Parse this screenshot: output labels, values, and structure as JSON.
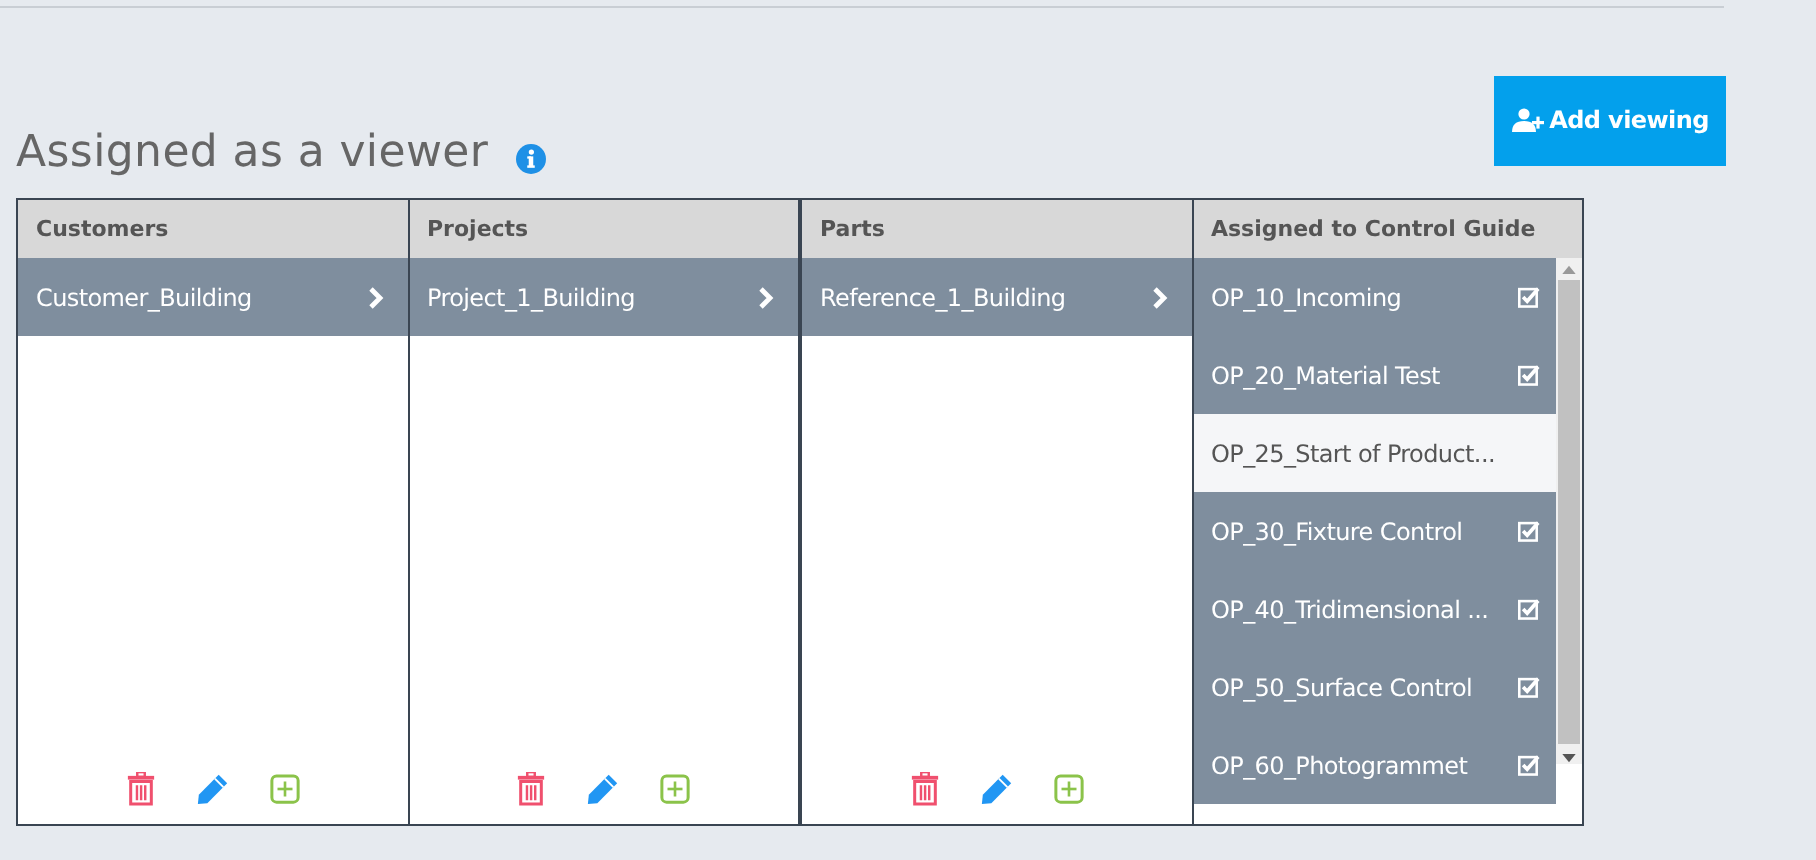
{
  "heading": "Assigned as a viewer",
  "add_button": "Add viewing",
  "columns": [
    {
      "title": "Customers",
      "items": [
        {
          "label": "Customer_Building",
          "selected": true
        }
      ]
    },
    {
      "title": "Projects",
      "items": [
        {
          "label": "Project_1_Building",
          "selected": true
        }
      ]
    },
    {
      "title": "Parts",
      "items": [
        {
          "label": "Reference_1_Building",
          "selected": true
        }
      ]
    }
  ],
  "guide": {
    "title": "Assigned to Control Guide",
    "items": [
      {
        "label": "OP_10_Incoming",
        "selected": true
      },
      {
        "label": "OP_20_Material Test",
        "selected": true
      },
      {
        "label": "OP_25_Start of Product...",
        "selected": false
      },
      {
        "label": "OP_30_Fixture Control",
        "selected": true
      },
      {
        "label": "OP_40_Tridimensional ...",
        "selected": true
      },
      {
        "label": "OP_50_Surface Control",
        "selected": true
      },
      {
        "label": "OP_60_Photogrammet",
        "selected": true
      }
    ]
  }
}
